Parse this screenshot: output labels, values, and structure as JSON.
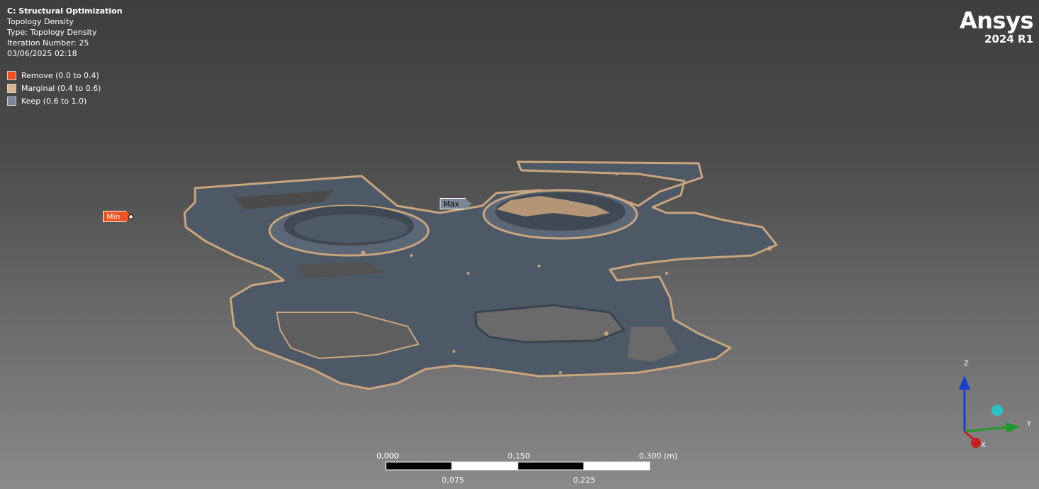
{
  "info": {
    "title": "C: Structural Optimization",
    "line1": "Topology Density",
    "line2": "Type: Topology Density",
    "line3": "Iteration Number: 25",
    "line4": "03/06/2025 02:18"
  },
  "legend": {
    "items": [
      {
        "label": "Remove (0.0 to 0.4)",
        "color": "#f0501e"
      },
      {
        "label": "Marginal (0.4 to 0.6)",
        "color": "#d9b48a"
      },
      {
        "label": "Keep (0.6 to 1.0)",
        "color": "#7a8696"
      }
    ]
  },
  "logo": {
    "brand": "Ansys",
    "version": "2024 R1"
  },
  "probes": {
    "min_label": "Min",
    "max_label": "Max"
  },
  "scale_bar": {
    "top_labels": [
      "0,000",
      "0,150",
      "0,300 (m)"
    ],
    "bottom_labels": [
      "0,075",
      "0,225"
    ]
  },
  "triad": {
    "x": "X",
    "y": "Y",
    "z": "Z"
  },
  "colors": {
    "keep": "#4f5a68",
    "marginal": "#c9a57e",
    "remove": "#f0501e"
  }
}
